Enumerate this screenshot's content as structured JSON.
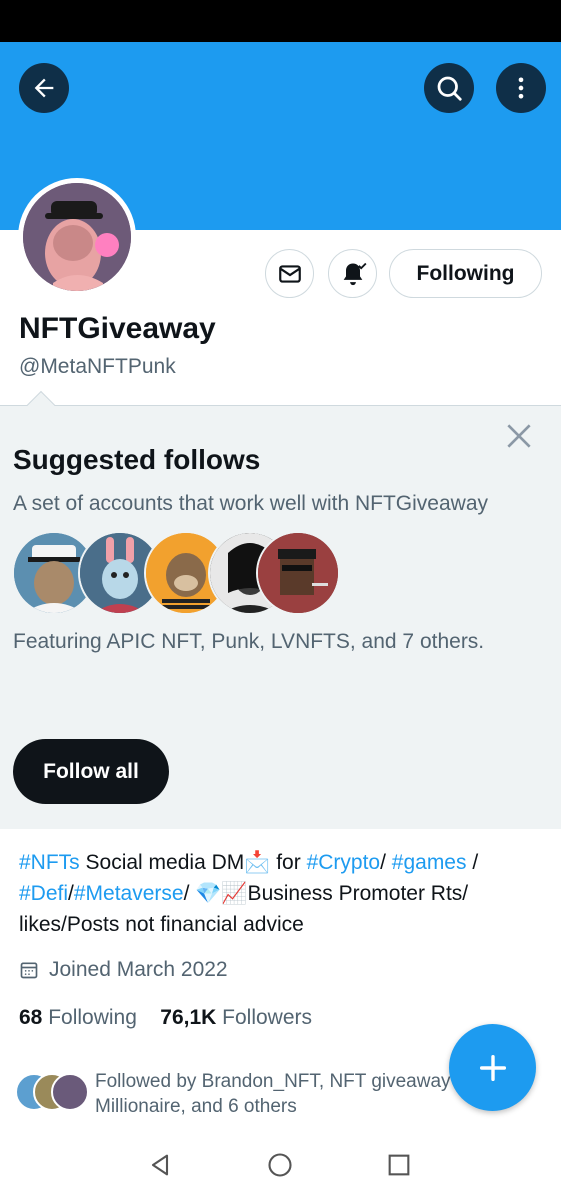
{
  "profile": {
    "display_name": "NFTGiveaway",
    "handle": "@MetaNFTPunk",
    "following_label": "Following",
    "bio_parts": [
      {
        "text": "#NFTs",
        "tag": true
      },
      {
        "text": " Social media DM📩 for ",
        "tag": false
      },
      {
        "text": "#Crypto",
        "tag": true
      },
      {
        "text": "/ ",
        "tag": false
      },
      {
        "text": "#games",
        "tag": true
      },
      {
        "text": " / ",
        "tag": false
      },
      {
        "text": "#Defi",
        "tag": true
      },
      {
        "text": "/",
        "tag": false
      },
      {
        "text": "#Metaverse",
        "tag": true
      },
      {
        "text": "/ 💎📈Business Promoter Rts/ likes/Posts not financial advice",
        "tag": false
      }
    ],
    "joined": "Joined March 2022",
    "following_count": "68",
    "following_text": "Following",
    "followers_count": "76,1K",
    "followers_text": "Followers",
    "followed_by": "Followed by Brandon_NFT, NFT giveaway\nMillionaire, and 6 others"
  },
  "suggested": {
    "title": "Suggested follows",
    "subtitle": "A set of accounts that work well with NFTGiveaway",
    "featuring": "Featuring APIC NFT, Punk, LVNFTS, and 7 others.",
    "follow_all_label": "Follow all"
  },
  "colors": {
    "accent": "#1d9bf0",
    "banner": "#1d9bf0",
    "dark": "#0f1419",
    "muted": "#536471"
  },
  "icons": [
    "back-arrow-icon",
    "search-icon",
    "more-vertical-icon",
    "mail-icon",
    "bell-check-icon",
    "close-icon",
    "calendar-icon",
    "plus-icon",
    "nav-back-icon",
    "nav-home-icon",
    "nav-recents-icon"
  ]
}
